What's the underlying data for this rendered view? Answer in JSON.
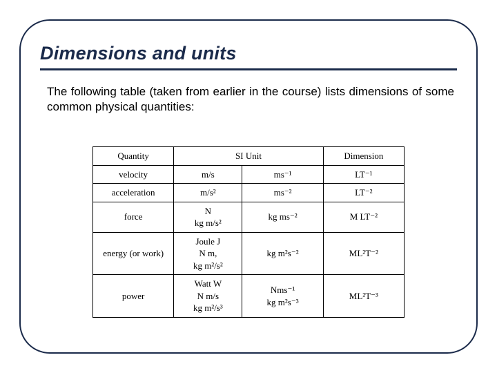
{
  "title": "Dimensions and units",
  "intro": "The following table (taken from earlier in the course) lists dimensions of some common physical quantities:",
  "table": {
    "headers": {
      "quantity": "Quantity",
      "si_unit": "SI Unit",
      "dimension": "Dimension"
    },
    "rows": [
      {
        "quantity": "velocity",
        "si_unit": "m/s",
        "si_equiv": "ms⁻¹",
        "dimension": "LT⁻¹"
      },
      {
        "quantity": "acceleration",
        "si_unit": "m/s²",
        "si_equiv": "ms⁻²",
        "dimension": "LT⁻²"
      },
      {
        "quantity": "force",
        "si_unit": "N\nkg m/s²",
        "si_equiv": "kg ms⁻²",
        "dimension": "M LT⁻²"
      },
      {
        "quantity": "energy (or work)",
        "si_unit": "Joule J\nN m,\nkg m²/s²",
        "si_equiv": "kg m²s⁻²",
        "dimension": "ML²T⁻²"
      },
      {
        "quantity": "power",
        "si_unit": "Watt W\nN m/s\nkg m²/s³",
        "si_equiv": "Nms⁻¹\nkg m²s⁻³",
        "dimension": "ML²T⁻³"
      }
    ]
  }
}
